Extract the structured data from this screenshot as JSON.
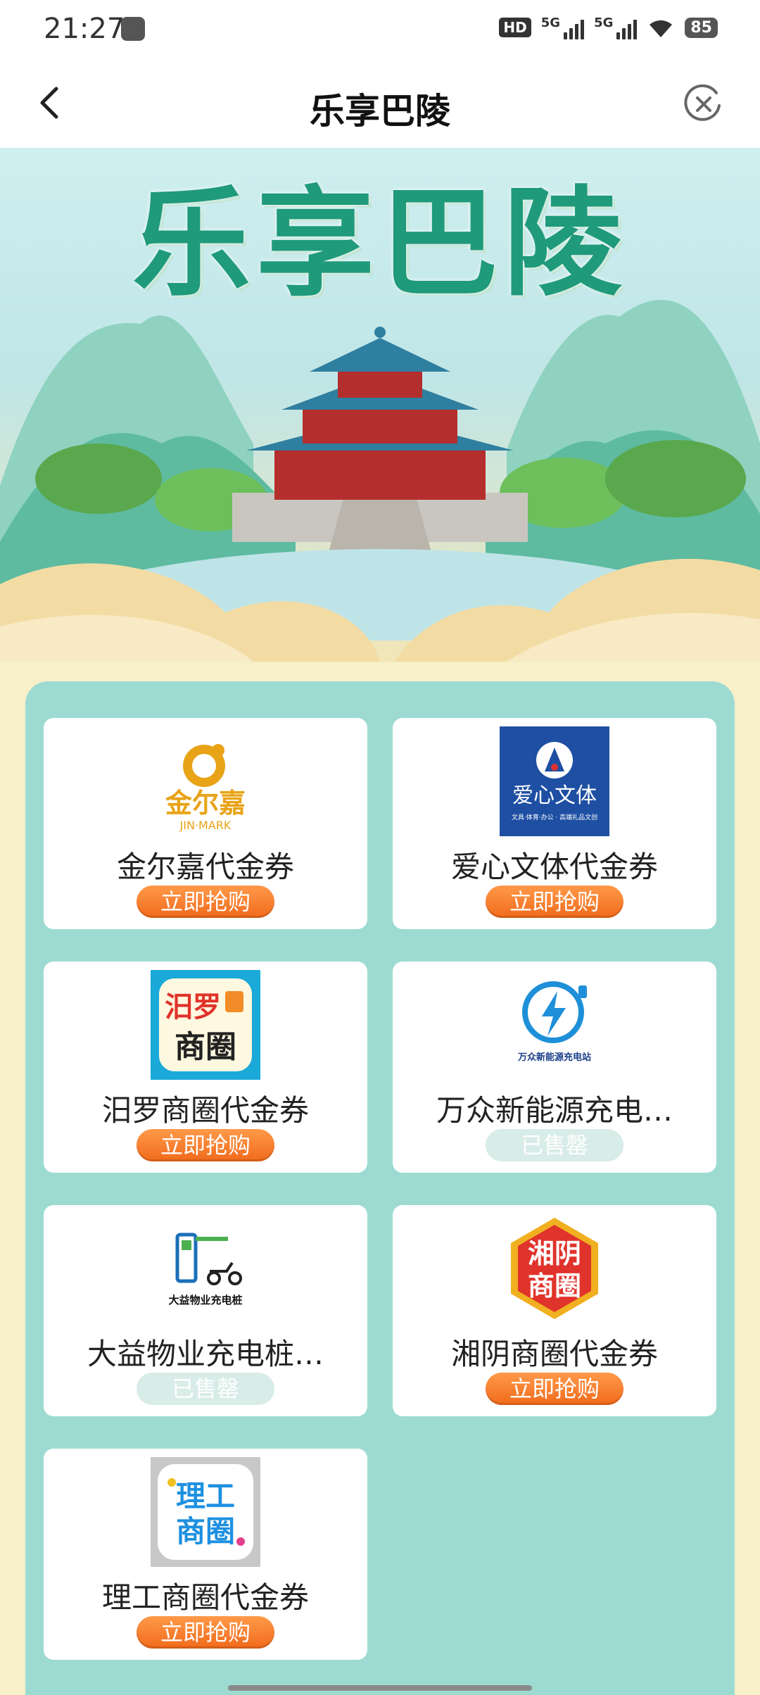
{
  "status_bar": {
    "time": "21:27",
    "hd": "HD",
    "sim1": "5G",
    "sim2": "5G",
    "battery": "85"
  },
  "nav": {
    "title": "乐享巴陵"
  },
  "hero": {
    "title": "乐享巴陵"
  },
  "logos": {
    "jinerjia": {
      "cn": "金尔嘉",
      "en": "JIN·MARK"
    },
    "aixin": {
      "cn": "爱心文体",
      "sub": "文具·体育·办公 · 高端礼品文创"
    },
    "miluo": {
      "cn1": "汨罗",
      "cn2": "商圈"
    },
    "wanzhong": {
      "cn": "万众新能源充电站"
    },
    "dayi": {
      "cn": "大益物业充电桩"
    },
    "xiangyin": {
      "cn1": "湘阴",
      "cn2": "商圈"
    },
    "ligong": {
      "cn1": "理工",
      "cn2": "商圈"
    }
  },
  "coupons": [
    {
      "name": "金尔嘉代金券",
      "button": "立即抢购",
      "status": "available"
    },
    {
      "name": "爱心文体代金券",
      "button": "立即抢购",
      "status": "available"
    },
    {
      "name": "汨罗商圈代金券",
      "button": "立即抢购",
      "status": "available"
    },
    {
      "name": "万众新能源充电…",
      "button": "已售罄",
      "status": "sold_out"
    },
    {
      "name": "大益物业充电桩…",
      "button": "已售罄",
      "status": "sold_out"
    },
    {
      "name": "湘阴商圈代金券",
      "button": "立即抢购",
      "status": "available"
    },
    {
      "name": "理工商圈代金券",
      "button": "立即抢购",
      "status": "available"
    }
  ],
  "colors": {
    "accent_orange": "#f16a1b",
    "panel_teal": "#9ddbd2",
    "hero_green": "#1f9a7b"
  }
}
